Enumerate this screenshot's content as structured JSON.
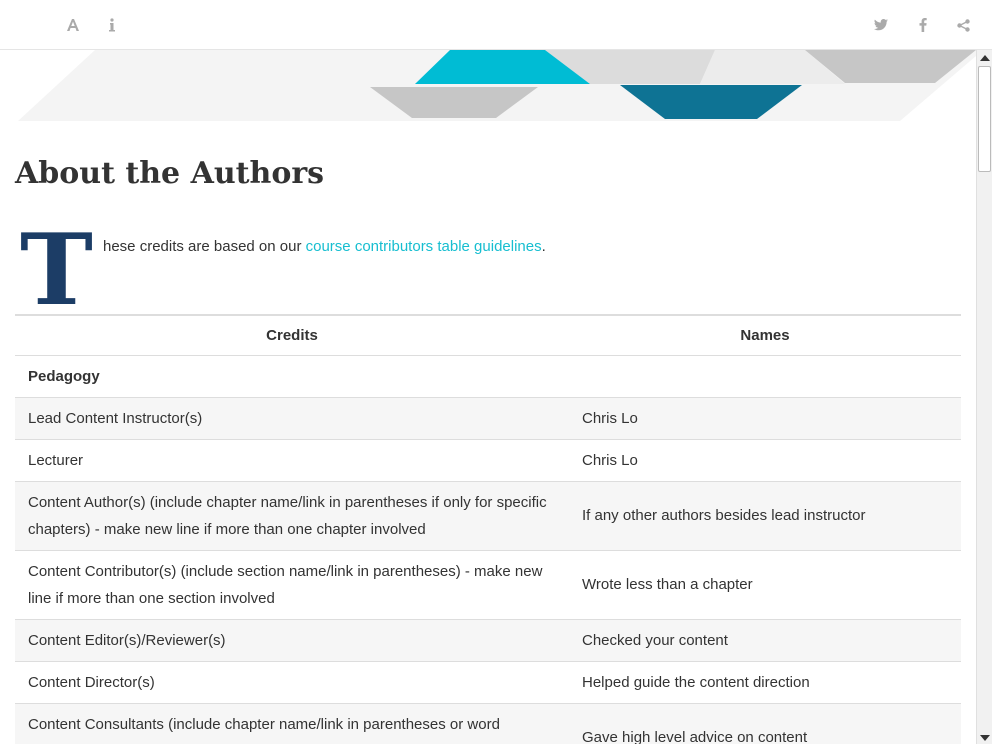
{
  "toolbar": {
    "left_icons": [
      "font-icon",
      "info-icon"
    ],
    "right_icons": [
      "twitter-icon",
      "facebook-icon",
      "share-icon"
    ]
  },
  "banner": {
    "colors": {
      "cyan": "#00bcd4",
      "teal": "#0e7394",
      "light_gray": "#dcdcdc",
      "mid_gray": "#c6c6c6",
      "pale_gray": "#ececec"
    }
  },
  "page": {
    "title": "About the Authors",
    "dropcap": "T",
    "intro_before": "hese credits are based on our ",
    "intro_link": "course contributors table guidelines",
    "intro_after": "."
  },
  "table": {
    "headers": [
      "Credits",
      "Names"
    ],
    "rows": [
      {
        "credit": "Pedagogy",
        "name": "",
        "section": true
      },
      {
        "credit": "Lead Content Instructor(s)",
        "name": "Chris Lo"
      },
      {
        "credit": "Lecturer",
        "name": "Chris Lo"
      },
      {
        "credit": "Content Author(s) (include chapter name/link in parentheses if only for specific chapters) - make new line if more than one chapter involved",
        "name": "If any other authors besides lead instructor"
      },
      {
        "credit": "Content Contributor(s) (include section name/link in parentheses) - make new line if more than one section involved",
        "name": "Wrote less than a chapter"
      },
      {
        "credit": "Content Editor(s)/Reviewer(s)",
        "name": "Checked your content"
      },
      {
        "credit": "Content Director(s)",
        "name": "Helped guide the content direction"
      },
      {
        "credit": "Content Consultants (include chapter name/link in parentheses or word “General”) - make new line if more than one chapter involved",
        "name": "Gave high level advice on content"
      }
    ]
  }
}
